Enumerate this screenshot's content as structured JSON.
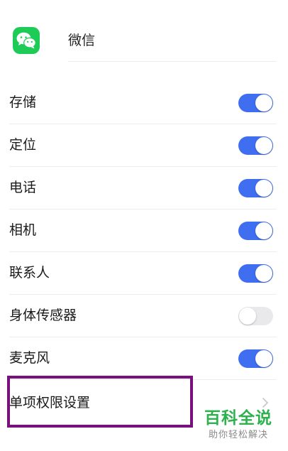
{
  "app": {
    "name": "微信",
    "icon": "wechat-icon",
    "icon_color": "#1ecb56"
  },
  "permissions": [
    {
      "label": "存储",
      "enabled": true
    },
    {
      "label": "定位",
      "enabled": true
    },
    {
      "label": "电话",
      "enabled": true
    },
    {
      "label": "相机",
      "enabled": true
    },
    {
      "label": "联系人",
      "enabled": true
    },
    {
      "label": "身体传感器",
      "enabled": false
    },
    {
      "label": "麦克风",
      "enabled": true
    }
  ],
  "single_permission": {
    "label": "单项权限设置",
    "icon": "chevron-right-icon"
  },
  "colors": {
    "toggle_on": "#3f6ff0",
    "toggle_off": "#e9e9ec",
    "highlight": "#7a0f7e",
    "watermark": "#2bb24c"
  },
  "watermark": {
    "title": "百科全说",
    "subtitle": "助你轻松解决"
  }
}
